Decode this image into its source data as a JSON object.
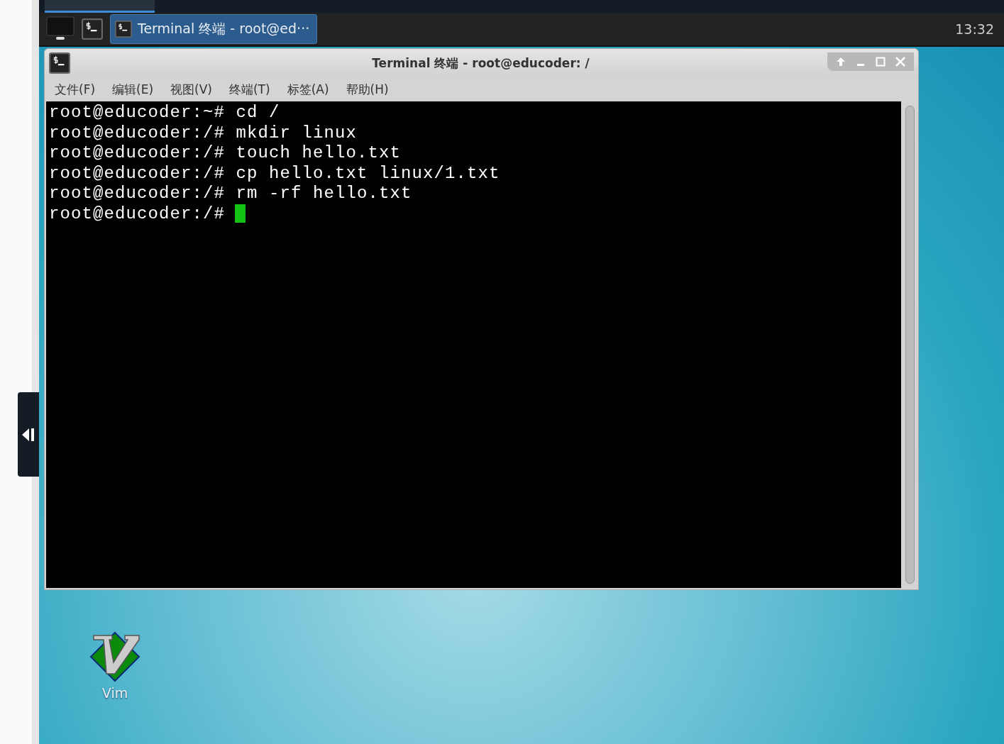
{
  "taskbar": {
    "window_button": {
      "label": "Terminal 终端 - root@ed···",
      "selected": true
    },
    "clock": "13:32"
  },
  "window": {
    "title": "Terminal 终端 - root@educoder: /",
    "menu": [
      "文件(F)",
      "编辑(E)",
      "视图(V)",
      "终端(T)",
      "标签(A)",
      "帮助(H)"
    ],
    "lines": [
      {
        "prompt": "root@educoder:~#",
        "command": "cd /"
      },
      {
        "prompt": "root@educoder:/#",
        "command": "mkdir linux"
      },
      {
        "prompt": "root@educoder:/#",
        "command": "touch hello.txt"
      },
      {
        "prompt": "root@educoder:/#",
        "command": "cp hello.txt linux/1.txt"
      },
      {
        "prompt": "root@educoder:/#",
        "command": "rm -rf hello.txt"
      },
      {
        "prompt": "root@educoder:/#",
        "cursor": true
      }
    ]
  },
  "desktop_icons": [
    {
      "label": "Vim"
    }
  ]
}
